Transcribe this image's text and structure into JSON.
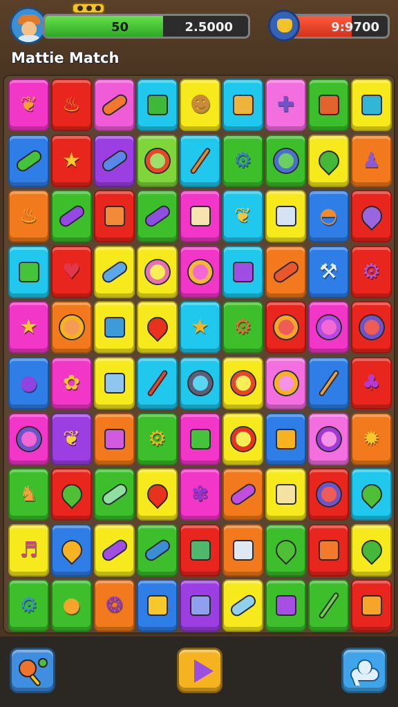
{
  "hud": {
    "player_label": "player avatar",
    "progress_value": "50",
    "score_value": "2.5000",
    "progress_fraction": 0.58,
    "currency_value": "9:9700",
    "currency_fraction": 0.62,
    "game_title": "Mattie Match"
  },
  "board": {
    "rows": [
      [
        {
          "color": "#f136c8",
          "icon": "banana-icon",
          "kind": "glyph",
          "glyph": "❦",
          "ink": "#f3a428"
        },
        {
          "color": "#e8261d",
          "icon": "flame-icon",
          "kind": "glyph",
          "glyph": "♨",
          "ink": "#f7b13a"
        },
        {
          "color": "#f05bd8",
          "icon": "capsule-icon",
          "kind": "capsule",
          "ink": "#f1782c"
        },
        {
          "color": "#21c8ee",
          "icon": "book-icon",
          "kind": "box",
          "ink": "#3fb83a"
        },
        {
          "color": "#f6e91c",
          "icon": "robot-icon",
          "kind": "glyph",
          "glyph": "☻",
          "ink": "#c98a3d"
        },
        {
          "color": "#21c8ee",
          "icon": "tv-icon",
          "kind": "box",
          "ink": "#f0b33a"
        },
        {
          "color": "#f36fe0",
          "icon": "puzzle-icon",
          "kind": "glyph",
          "glyph": "✚",
          "ink": "#6b55c9"
        },
        {
          "color": "#3cbf2b",
          "icon": "backpack-icon",
          "kind": "box",
          "ink": "#e4622b"
        },
        {
          "color": "#f6e91c",
          "icon": "camera-icon",
          "kind": "box",
          "ink": "#31b6d8"
        }
      ],
      [
        {
          "color": "#2f7ee8",
          "icon": "phone-icon",
          "kind": "capsule",
          "ink": "#45c33a"
        },
        {
          "color": "#e8261d",
          "icon": "star-icon",
          "kind": "glyph",
          "glyph": "★",
          "ink": "#f6cb2c"
        },
        {
          "color": "#9b3fe3",
          "icon": "capsule-icon",
          "kind": "capsule",
          "ink": "#5a87e8"
        },
        {
          "color": "#7fd63a",
          "icon": "disc-icon",
          "kind": "ring",
          "ink": "#e8462a"
        },
        {
          "color": "#21c8ee",
          "icon": "brush-icon",
          "kind": "wand",
          "ink": "#e08a2a"
        },
        {
          "color": "#3cbf2b",
          "icon": "gear-icon",
          "kind": "glyph",
          "glyph": "⚙",
          "ink": "#3a7ad6"
        },
        {
          "color": "#3cbf2b",
          "icon": "ring-icon",
          "kind": "ring",
          "ink": "#4b6fd1"
        },
        {
          "color": "#f6e91c",
          "icon": "bottle-icon",
          "kind": "drop",
          "ink": "#45b83a"
        },
        {
          "color": "#f27a1c",
          "icon": "pawn-icon",
          "kind": "glyph",
          "glyph": "♟",
          "ink": "#8a5ad9"
        }
      ],
      [
        {
          "color": "#f27a1c",
          "icon": "flame-icon",
          "kind": "glyph",
          "glyph": "♨",
          "ink": "#f6b73a"
        },
        {
          "color": "#3cbf2b",
          "icon": "capsule-icon",
          "kind": "capsule",
          "ink": "#9548e3"
        },
        {
          "color": "#e8261d",
          "icon": "block-icon",
          "kind": "box",
          "ink": "#f28a3a"
        },
        {
          "color": "#3cbf2b",
          "icon": "capsule-icon",
          "kind": "capsule",
          "ink": "#8d4fe0"
        },
        {
          "color": "#f136c8",
          "icon": "tile-icon",
          "kind": "box",
          "ink": "#f7e3b0"
        },
        {
          "color": "#21c8ee",
          "icon": "banana-icon",
          "kind": "glyph",
          "glyph": "❦",
          "ink": "#f6c33a"
        },
        {
          "color": "#f6e91c",
          "icon": "dice-icon",
          "kind": "box",
          "ink": "#d6e3f5"
        },
        {
          "color": "#2f7ee8",
          "icon": "shell-icon",
          "kind": "glyph",
          "glyph": "◓",
          "ink": "#f08a2a"
        },
        {
          "color": "#e8261d",
          "icon": "feather-icon",
          "kind": "drop",
          "ink": "#9a66e0"
        }
      ],
      [
        {
          "color": "#21c8ee",
          "icon": "bag-icon",
          "kind": "box",
          "ink": "#45c33a"
        },
        {
          "color": "#e8261d",
          "icon": "strawberry-icon",
          "kind": "glyph",
          "glyph": "♥",
          "ink": "#e0384a"
        },
        {
          "color": "#f6e91c",
          "icon": "capsule-icon",
          "kind": "capsule",
          "ink": "#5aa8ea"
        },
        {
          "color": "#f6e91c",
          "icon": "lollipop-icon",
          "kind": "ring",
          "ink": "#e86fb3"
        },
        {
          "color": "#f136c8",
          "icon": "ring-icon",
          "kind": "ring",
          "ink": "#f6b73a"
        },
        {
          "color": "#21c8ee",
          "icon": "gem-icon",
          "kind": "box",
          "ink": "#a04de3"
        },
        {
          "color": "#f27a1c",
          "icon": "capsule-icon",
          "kind": "capsule",
          "ink": "#e8562a"
        },
        {
          "color": "#2f7ee8",
          "icon": "tool-icon",
          "kind": "glyph",
          "glyph": "⚒",
          "ink": "#e6eef6"
        },
        {
          "color": "#e8261d",
          "icon": "gear-icon",
          "kind": "glyph",
          "glyph": "⚙",
          "ink": "#a25be0"
        }
      ],
      [
        {
          "color": "#f136c8",
          "icon": "star-icon",
          "kind": "glyph",
          "glyph": "★",
          "ink": "#f6cb2c"
        },
        {
          "color": "#f27a1c",
          "icon": "orange-icon",
          "kind": "ring",
          "ink": "#f6b21f"
        },
        {
          "color": "#f6e91c",
          "icon": "box-icon",
          "kind": "box",
          "ink": "#3c9bd8"
        },
        {
          "color": "#f6e91c",
          "icon": "pepper-icon",
          "kind": "drop",
          "ink": "#e8321d"
        },
        {
          "color": "#21c8ee",
          "icon": "star-icon",
          "kind": "glyph",
          "glyph": "★",
          "ink": "#f6b21f"
        },
        {
          "color": "#3cbf2b",
          "icon": "gear-icon",
          "kind": "glyph",
          "glyph": "⚙",
          "ink": "#f0693a"
        },
        {
          "color": "#e8261d",
          "icon": "gear-icon",
          "kind": "ring",
          "ink": "#f6a52a"
        },
        {
          "color": "#f136c8",
          "icon": "donut-icon",
          "kind": "ring",
          "ink": "#b04be3"
        },
        {
          "color": "#e8261d",
          "icon": "badge-icon",
          "kind": "ring",
          "ink": "#6b55c9"
        }
      ],
      [
        {
          "color": "#2f7ee8",
          "icon": "potion-icon",
          "kind": "glyph",
          "glyph": "●",
          "ink": "#8f43e0"
        },
        {
          "color": "#f136c8",
          "icon": "puzzle-icon",
          "kind": "glyph",
          "glyph": "✿",
          "ink": "#f6c82a"
        },
        {
          "color": "#f6e91c",
          "icon": "dice-icon",
          "kind": "box",
          "ink": "#8fc6ef"
        },
        {
          "color": "#21c8ee",
          "icon": "brush-icon",
          "kind": "wand",
          "ink": "#e8462a"
        },
        {
          "color": "#21c8ee",
          "icon": "lens-icon",
          "kind": "ring",
          "ink": "#5d5d78"
        },
        {
          "color": "#f6e91c",
          "icon": "lens-icon",
          "kind": "ring",
          "ink": "#e8462a"
        },
        {
          "color": "#f36fe0",
          "icon": "ring-icon",
          "kind": "ring",
          "ink": "#f6b21f"
        },
        {
          "color": "#2f7ee8",
          "icon": "brush-icon",
          "kind": "wand",
          "ink": "#e8a23a"
        },
        {
          "color": "#e8261d",
          "icon": "cherry-icon",
          "kind": "glyph",
          "glyph": "♣",
          "ink": "#b23ad6"
        }
      ],
      [
        {
          "color": "#f136c8",
          "icon": "ring-icon",
          "kind": "ring",
          "ink": "#6b55c9"
        },
        {
          "color": "#9b3fe3",
          "icon": "banana-icon",
          "kind": "glyph",
          "glyph": "❦",
          "ink": "#f6d23a"
        },
        {
          "color": "#f27a1c",
          "icon": "bag-icon",
          "kind": "box",
          "ink": "#d05ae0"
        },
        {
          "color": "#3cbf2b",
          "icon": "gear-icon",
          "kind": "glyph",
          "glyph": "⚙",
          "ink": "#f6b21f"
        },
        {
          "color": "#f136c8",
          "icon": "sign-icon",
          "kind": "box",
          "ink": "#45c33a"
        },
        {
          "color": "#f6e91c",
          "icon": "bug-icon",
          "kind": "ring",
          "ink": "#e8321d"
        },
        {
          "color": "#2f7ee8",
          "icon": "radio-icon",
          "kind": "box",
          "ink": "#f6b21f"
        },
        {
          "color": "#f36fe0",
          "icon": "ring-icon",
          "kind": "ring",
          "ink": "#a03ad6"
        },
        {
          "color": "#f27a1c",
          "icon": "sun-icon",
          "kind": "glyph",
          "glyph": "✹",
          "ink": "#f6c82a"
        }
      ],
      [
        {
          "color": "#3cbf2b",
          "icon": "sock-icon",
          "kind": "glyph",
          "glyph": "♞",
          "ink": "#f2a23a"
        },
        {
          "color": "#e8261d",
          "icon": "bottle-icon",
          "kind": "drop",
          "ink": "#4fc036"
        },
        {
          "color": "#3cbf2b",
          "icon": "capsule-icon",
          "kind": "capsule",
          "ink": "#8fe0a0"
        },
        {
          "color": "#f6e91c",
          "icon": "pepper-icon",
          "kind": "drop",
          "ink": "#e8321d"
        },
        {
          "color": "#f136c8",
          "icon": "flower-icon",
          "kind": "glyph",
          "glyph": "✾",
          "ink": "#8a3ad0"
        },
        {
          "color": "#f27a1c",
          "icon": "capsule-icon",
          "kind": "capsule",
          "ink": "#c04fe0"
        },
        {
          "color": "#f6e91c",
          "icon": "note-icon",
          "kind": "box",
          "ink": "#f3e2a0"
        },
        {
          "color": "#e8261d",
          "icon": "badge-icon",
          "kind": "ring",
          "ink": "#6b55c9"
        },
        {
          "color": "#21c8ee",
          "icon": "leaf-icon",
          "kind": "drop",
          "ink": "#4fc036"
        }
      ],
      [
        {
          "color": "#f6e91c",
          "icon": "horn-icon",
          "kind": "glyph",
          "glyph": "♬",
          "ink": "#d0409a"
        },
        {
          "color": "#2f7ee8",
          "icon": "drop-icon",
          "kind": "drop",
          "ink": "#f6b21f"
        },
        {
          "color": "#f6e91c",
          "icon": "capsule-icon",
          "kind": "capsule",
          "ink": "#a04de3"
        },
        {
          "color": "#3cbf2b",
          "icon": "camera-icon",
          "kind": "capsule",
          "ink": "#3a8ed6"
        },
        {
          "color": "#e8261d",
          "icon": "cube-icon",
          "kind": "box",
          "ink": "#4fb86a"
        },
        {
          "color": "#f27a1c",
          "icon": "dice-icon",
          "kind": "box",
          "ink": "#dfe8f3"
        },
        {
          "color": "#3cbf2b",
          "icon": "bottle-icon",
          "kind": "drop",
          "ink": "#4fc036"
        },
        {
          "color": "#e8261d",
          "icon": "backpack-icon",
          "kind": "box",
          "ink": "#f27a2a"
        },
        {
          "color": "#f6e91c",
          "icon": "bottle-icon",
          "kind": "drop",
          "ink": "#45b83a"
        }
      ],
      [
        {
          "color": "#3cbf2b",
          "icon": "gear-icon",
          "kind": "glyph",
          "glyph": "⚙",
          "ink": "#3a8ed6"
        },
        {
          "color": "#3cbf2b",
          "icon": "apple-icon",
          "kind": "glyph",
          "glyph": "●",
          "ink": "#f6a52a"
        },
        {
          "color": "#f27a1c",
          "icon": "grape-icon",
          "kind": "glyph",
          "glyph": "❂",
          "ink": "#8a3ad0"
        },
        {
          "color": "#2f7ee8",
          "icon": "jar-icon",
          "kind": "box",
          "ink": "#f6c82a"
        },
        {
          "color": "#9b3fe3",
          "icon": "gem-icon",
          "kind": "box",
          "ink": "#8fa0ef"
        },
        {
          "color": "#f6e91c",
          "icon": "clip-icon",
          "kind": "capsule",
          "ink": "#8fd0ef"
        },
        {
          "color": "#3cbf2b",
          "icon": "gem-icon",
          "kind": "box",
          "ink": "#a84fe3"
        },
        {
          "color": "#3cbf2b",
          "icon": "brush-icon",
          "kind": "wand",
          "ink": "#6fd04a"
        },
        {
          "color": "#e8261d",
          "icon": "box-icon",
          "kind": "box",
          "ink": "#f6a52a"
        }
      ]
    ]
  },
  "footer": {
    "hint_icon": "hint-icon",
    "play_icon": "play-icon",
    "cloud_icon": "cloud-icon"
  }
}
